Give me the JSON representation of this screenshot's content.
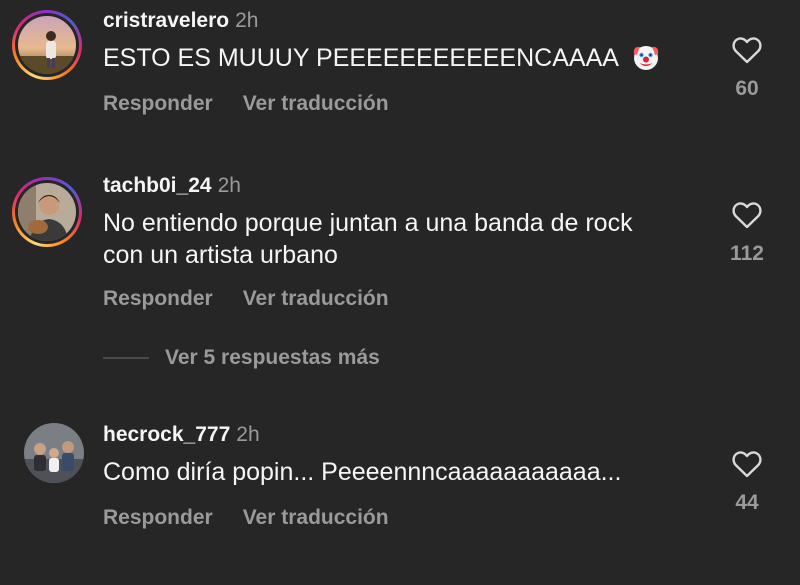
{
  "comments": [
    {
      "username": "cristravelero",
      "time": "2h",
      "text": "ESTO ES MUUUY PEEEEEEEEEEENCAAAA",
      "emoji_icon": "clown-face-icon",
      "reply_label": "Responder",
      "translate_label": "Ver traducción",
      "likes": "60"
    },
    {
      "username": "tachb0i_24",
      "time": "2h",
      "text": "No entiendo porque juntan a una banda de rock con un artista urbano",
      "reply_label": "Responder",
      "translate_label": "Ver traducción",
      "likes": "112",
      "replies_label": "Ver 5 respuestas más"
    },
    {
      "username": "hecrock_777",
      "time": "2h",
      "text": "Como diría popin... Peeeennncaaaaaaaaaaa...",
      "reply_label": "Responder",
      "translate_label": "Ver traducción",
      "likes": "44"
    }
  ],
  "colors": {
    "background": "#262626",
    "primary_text": "#f5f5f5",
    "secondary_text": "#9a9a9a"
  }
}
